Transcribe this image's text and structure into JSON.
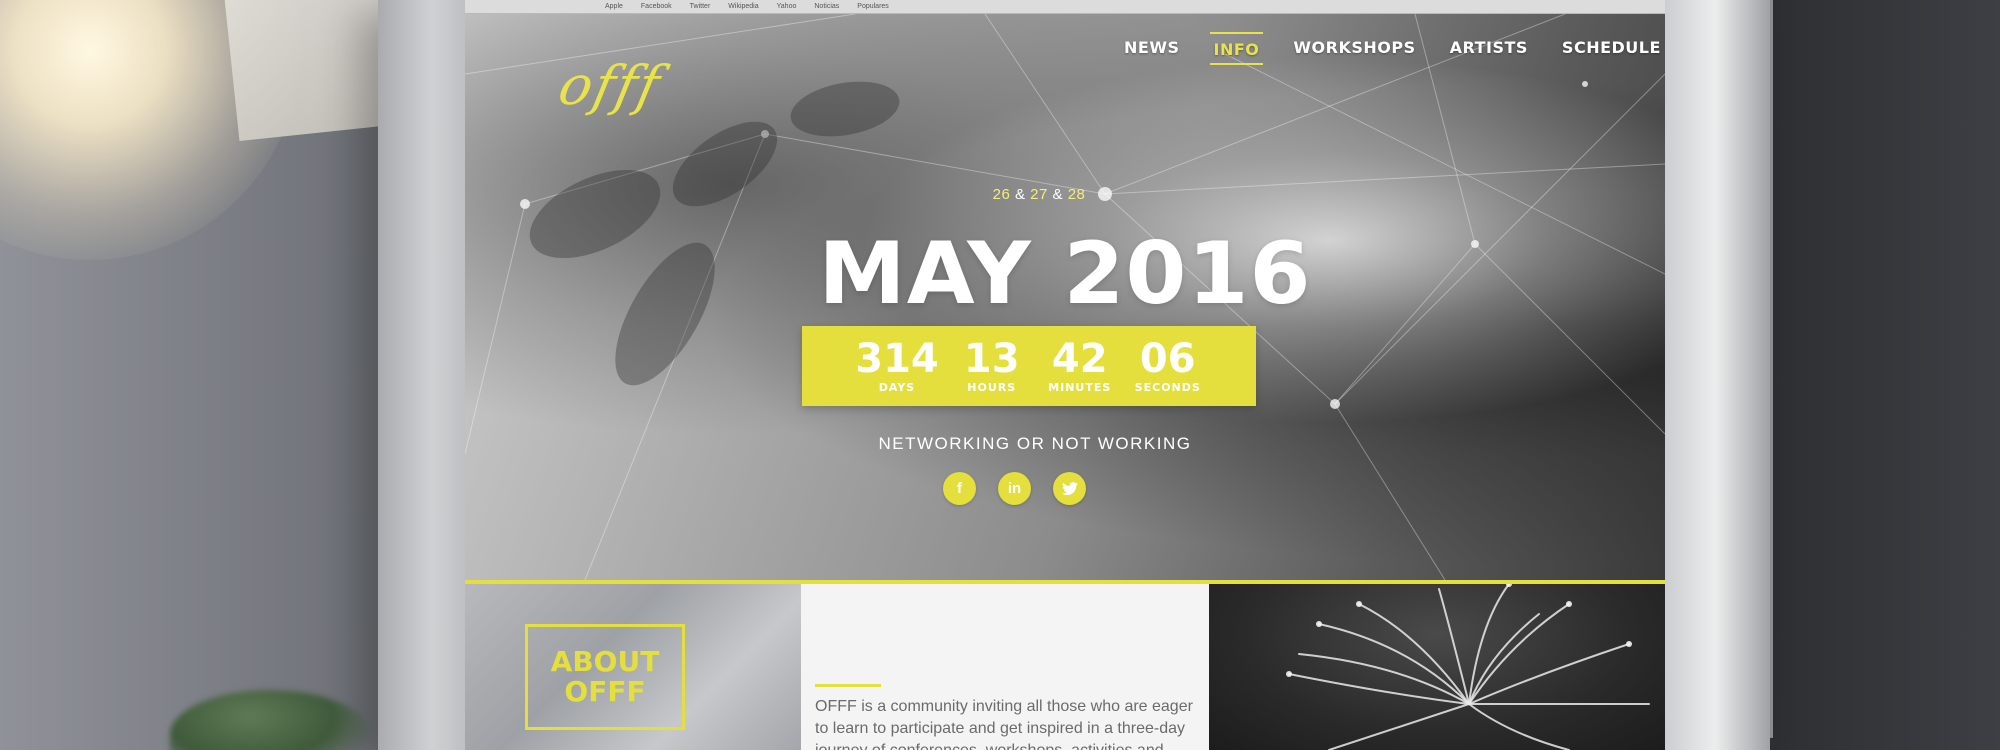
{
  "browser": {
    "bookmarks": [
      "Apple",
      "Facebook",
      "Twitter",
      "Wikipedia",
      "Yahoo",
      "Noticias",
      "Populares"
    ]
  },
  "site": {
    "logo_text": "offf",
    "nav": [
      {
        "label": "NEWS",
        "active": false
      },
      {
        "label": "INFO",
        "active": true
      },
      {
        "label": "WORKSHOPS",
        "active": false
      },
      {
        "label": "ARTISTS",
        "active": false
      },
      {
        "label": "SCHEDULE",
        "active": false
      }
    ]
  },
  "hero": {
    "date_1": "26",
    "amp": "&",
    "date_2": "27",
    "date_3": "28",
    "title": "MAY 2016",
    "countdown": [
      {
        "value": "314",
        "label": "DAYS"
      },
      {
        "value": "13",
        "label": "HOURS"
      },
      {
        "value": "42",
        "label": "MINUTES"
      },
      {
        "value": "06",
        "label": "SECONDS"
      }
    ],
    "tagline": "NETWORKING OR NOT WORKING",
    "social": [
      {
        "icon": "facebook-icon",
        "glyph": "f"
      },
      {
        "icon": "linkedin-icon",
        "glyph": "in"
      },
      {
        "icon": "twitter-icon",
        "glyph": "t"
      }
    ]
  },
  "about": {
    "heading_line1": "ABOUT",
    "heading_line2": "OFFF",
    "text": "OFFF is a community inviting all those who are eager to learn to participate and get inspired in a three-day journey of conferences, workshops, activities and"
  },
  "colors": {
    "accent": "#e4df3c",
    "text_light": "#ffffff",
    "body_text": "#6b6b6b"
  }
}
